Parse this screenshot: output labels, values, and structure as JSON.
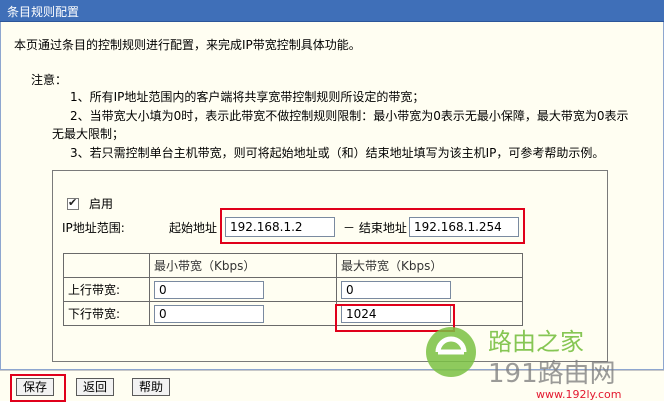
{
  "window": {
    "title": "条目规则配置"
  },
  "intro": "本页通过条目的控制规则进行配置，来完成IP带宽控制具体功能。",
  "notes": {
    "title": "注意：",
    "n1": "1、所有IP地址范围内的客户端将共享宽带控制规则所设定的带宽；",
    "n2": "2、当带宽大小填为0时，表示此带宽不做控制规则限制：最小带宽为0表示无最小保障，最大带宽为0表示",
    "n2b": "无最大限制；",
    "n3": "3、若只需控制单台主机带宽，则可将起始地址或（和）结束地址填写为该主机IP，可参考帮助示例。"
  },
  "form": {
    "enable_label": "启用",
    "ip_range_label": "IP地址范围:",
    "start_label": "起始地址",
    "end_label": "－ 结束地址",
    "start_ip": "192.168.1.2",
    "end_ip": "192.168.1.254"
  },
  "bandwidth_table": {
    "headers": [
      "",
      "最小带宽（Kbps）",
      "最大带宽（Kbps）"
    ],
    "rows": [
      {
        "label": "上行带宽:",
        "min": "0",
        "max": "0"
      },
      {
        "label": "下行带宽:",
        "min": "0",
        "max": "1024"
      }
    ]
  },
  "buttons": {
    "save": "保存",
    "back": "返回",
    "help": "帮助"
  },
  "watermark": {
    "brand": "路由之家",
    "number": "191路由网",
    "url": "www.192ly.com"
  },
  "colors": {
    "titlebar": "#3f6fb8",
    "highlight": "#e0001b",
    "panel": "#fffef2",
    "logo_green": "#7ac143"
  }
}
